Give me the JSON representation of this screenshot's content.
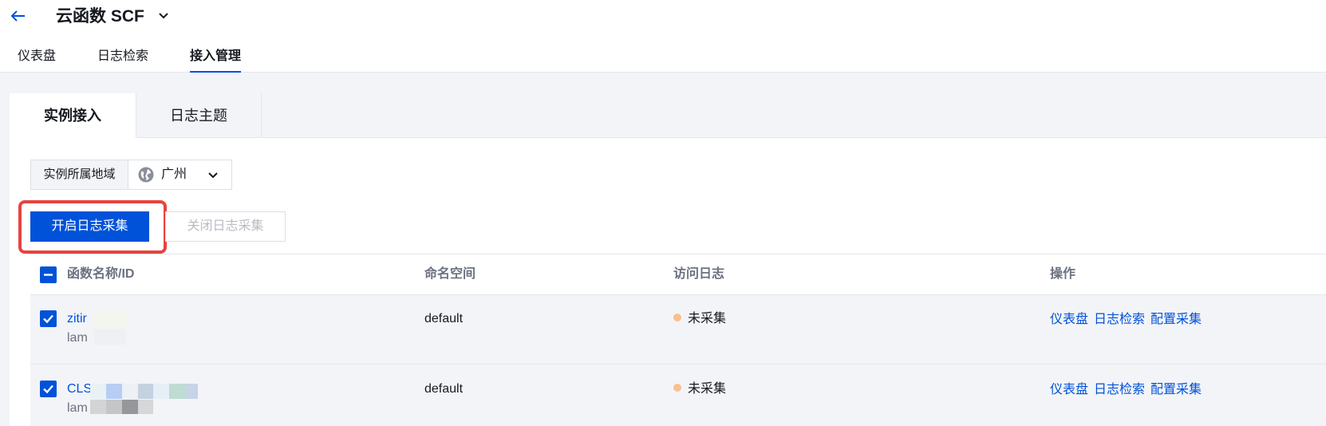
{
  "header": {
    "title": "云函数 SCF",
    "tabs": [
      {
        "label": "仪表盘",
        "active": false
      },
      {
        "label": "日志检索",
        "active": false
      },
      {
        "label": "接入管理",
        "active": true
      }
    ]
  },
  "inner_tabs": [
    {
      "label": "实例接入",
      "active": true
    },
    {
      "label": "日志主题",
      "active": false
    }
  ],
  "region": {
    "label": "实例所属地域",
    "value": "广州"
  },
  "buttons": {
    "enable": "开启日志采集",
    "disable": "关闭日志采集"
  },
  "table": {
    "columns": [
      "函数名称/ID",
      "命名空间",
      "访问日志",
      "操作"
    ],
    "rows": [
      {
        "name": "zitir",
        "id": "lam",
        "namespace": "default",
        "status": "未采集",
        "actions": [
          "仪表盘",
          "日志检索",
          "配置采集"
        ]
      },
      {
        "name": "CLS",
        "id": "lam",
        "namespace": "default",
        "status": "未采集",
        "actions": [
          "仪表盘",
          "日志检索",
          "配置采集"
        ]
      }
    ]
  },
  "colors": {
    "accent": "#0052d9",
    "highlight": "#e64340",
    "status_dot": "#f9c08d"
  }
}
